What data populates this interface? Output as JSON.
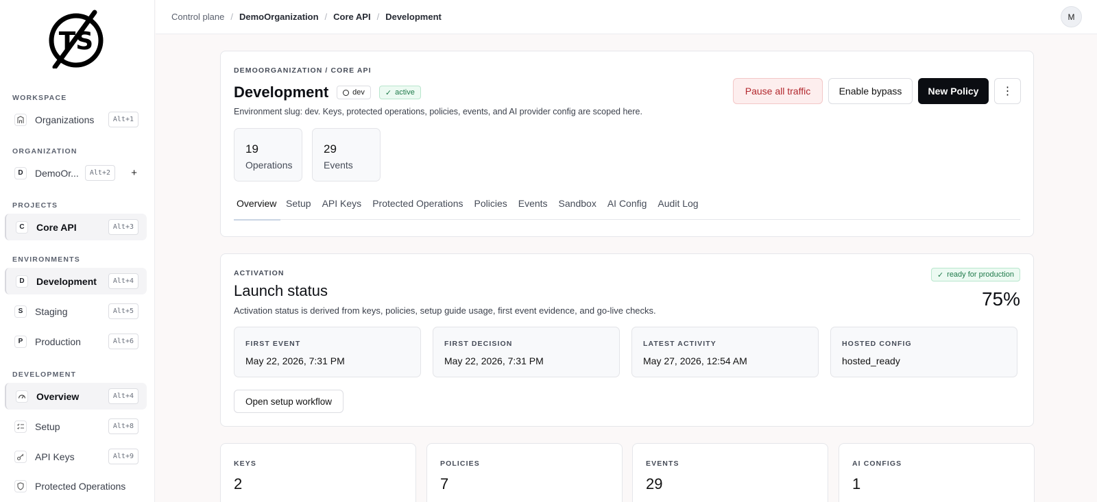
{
  "sidebar": {
    "sections": {
      "workspace": "WORKSPACE",
      "organization": "ORGANIZATION",
      "projects": "PROJECTS",
      "environments": "ENVIRONMENTS",
      "development": "DEVELOPMENT"
    },
    "workspace_items": [
      {
        "icon": "building-icon",
        "label": "Organizations",
        "shortcut": "Alt+1"
      }
    ],
    "organization_items": [
      {
        "badge": "D",
        "label": "DemoOr...",
        "shortcut": "Alt+2",
        "add": "+"
      }
    ],
    "project_items": [
      {
        "badge": "C",
        "label": "Core API",
        "shortcut": "Alt+3",
        "active": true
      }
    ],
    "environment_items": [
      {
        "badge": "D",
        "label": "Development",
        "shortcut": "Alt+4",
        "active": true
      },
      {
        "badge": "S",
        "label": "Staging",
        "shortcut": "Alt+5"
      },
      {
        "badge": "P",
        "label": "Production",
        "shortcut": "Alt+6"
      }
    ],
    "development_items": [
      {
        "icon": "gauge-icon",
        "label": "Overview",
        "shortcut": "Alt+4",
        "active": true
      },
      {
        "icon": "checklist-icon",
        "label": "Setup",
        "shortcut": "Alt+8"
      },
      {
        "icon": "key-icon",
        "label": "API Keys",
        "shortcut": "Alt+9"
      },
      {
        "icon": "shield-icon",
        "label": "Protected Operations",
        "shortcut": ""
      }
    ]
  },
  "topbar": {
    "breadcrumbs": [
      "Control plane",
      "DemoOrganization",
      "Core API",
      "Development"
    ],
    "avatar_initial": "M"
  },
  "header": {
    "eyebrow": "DEMOORGANIZATION / CORE API",
    "title": "Development",
    "env_pill": "dev",
    "status_pill": "active",
    "description": "Environment slug: dev. Keys, protected operations, policies, events, and AI provider config are scoped here.",
    "buttons": {
      "pause": "Pause all traffic",
      "bypass": "Enable bypass",
      "new_policy": "New Policy",
      "more": "⋮"
    },
    "stats": [
      {
        "value": "19",
        "label": "Operations"
      },
      {
        "value": "29",
        "label": "Events"
      }
    ],
    "tabs": [
      "Overview",
      "Setup",
      "API Keys",
      "Protected Operations",
      "Policies",
      "Events",
      "Sandbox",
      "AI Config",
      "Audit Log"
    ],
    "active_tab": "Overview"
  },
  "activation": {
    "eyebrow": "ACTIVATION",
    "title": "Launch status",
    "description": "Activation status is derived from keys, policies, setup guide usage, first event evidence, and go-live checks.",
    "badge": "ready for production",
    "percent": "75%",
    "boxes": [
      {
        "label": "FIRST EVENT",
        "value": "May 22, 2026, 7:31 PM"
      },
      {
        "label": "FIRST DECISION",
        "value": "May 22, 2026, 7:31 PM"
      },
      {
        "label": "LATEST ACTIVITY",
        "value": "May 27, 2026, 12:54 AM"
      },
      {
        "label": "HOSTED CONFIG",
        "value": "hosted_ready"
      }
    ],
    "setup_button": "Open setup workflow"
  },
  "metrics": [
    {
      "label": "KEYS",
      "value": "2"
    },
    {
      "label": "POLICIES",
      "value": "7"
    },
    {
      "label": "EVENTS",
      "value": "29"
    },
    {
      "label": "AI CONFIGS",
      "value": "1"
    }
  ]
}
